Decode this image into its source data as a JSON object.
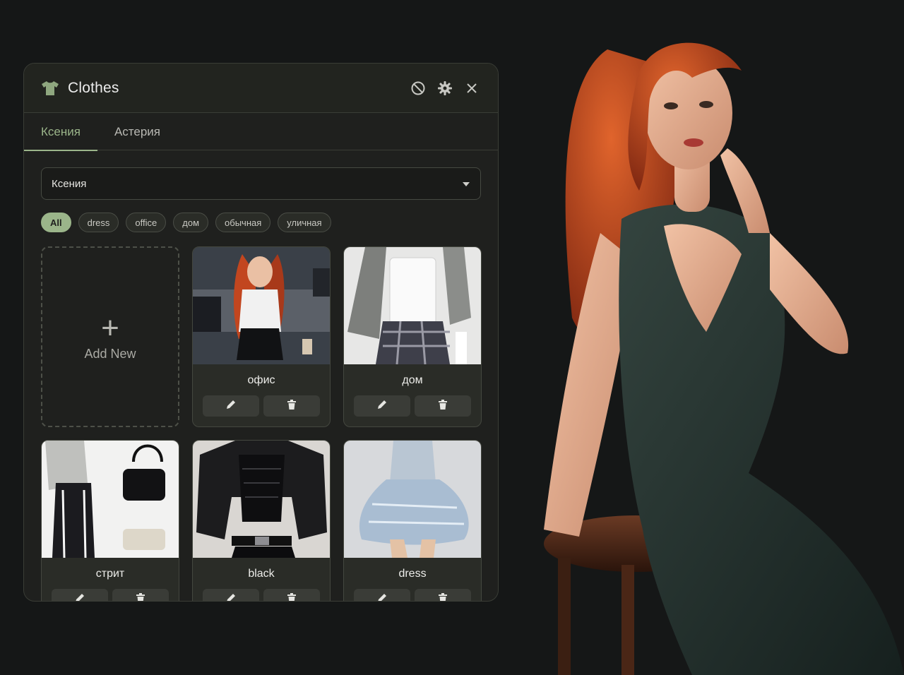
{
  "panel": {
    "title": "Clothes",
    "icons": {
      "title": "tshirt-icon",
      "block": "block-icon",
      "settings": "gear-icon",
      "close": "close-icon"
    }
  },
  "tabs": [
    {
      "label": "Ксения",
      "active": true
    },
    {
      "label": "Астерия",
      "active": false
    }
  ],
  "character_select": {
    "value": "Ксения"
  },
  "filters": [
    {
      "label": "All",
      "active": true
    },
    {
      "label": "dress",
      "active": false
    },
    {
      "label": "office",
      "active": false
    },
    {
      "label": "дом",
      "active": false
    },
    {
      "label": "обычная",
      "active": false
    },
    {
      "label": "уличная",
      "active": false
    }
  ],
  "add_card": {
    "label": "Add New"
  },
  "outfits": [
    {
      "name": "офис"
    },
    {
      "name": "дом"
    },
    {
      "name": "стрит"
    },
    {
      "name": "black"
    },
    {
      "name": "dress"
    }
  ],
  "colors": {
    "accent": "#9bb58a",
    "panel_bg": "#1f201e",
    "page_bg": "#151717"
  }
}
